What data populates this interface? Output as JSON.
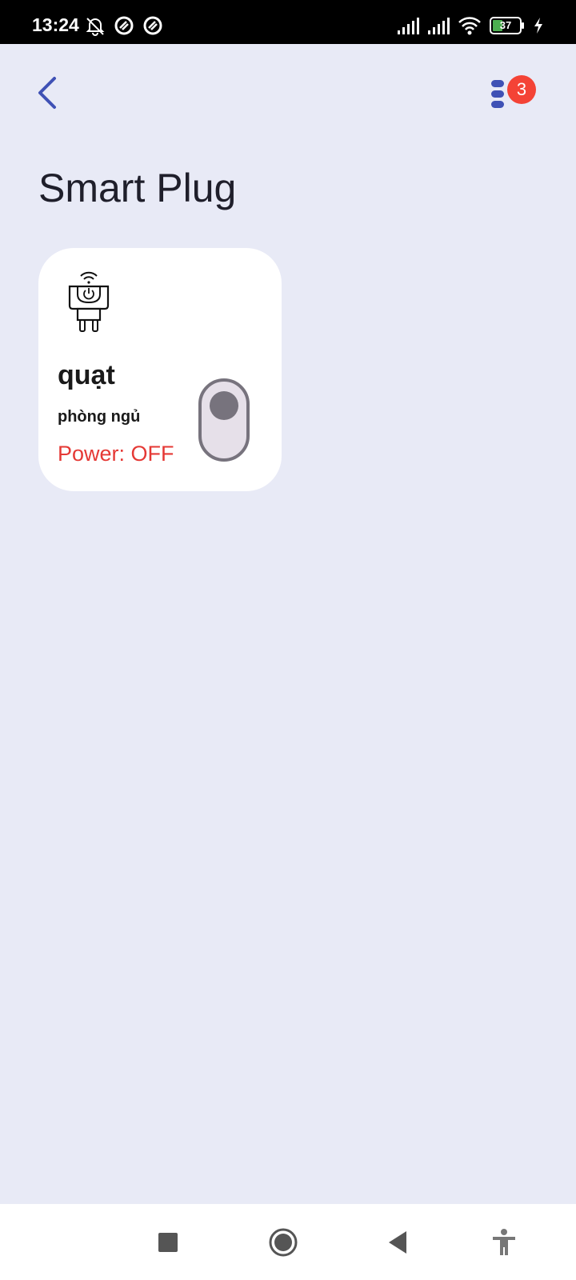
{
  "status_bar": {
    "time": "13:24",
    "battery": "37",
    "icons": [
      "muted-bell-icon",
      "sync-icon",
      "sync-icon",
      "signal-icon",
      "signal-icon",
      "wifi-icon",
      "battery-icon",
      "charging-icon"
    ]
  },
  "header": {
    "back_icon": "chevron-left-icon",
    "menu_icon": "menu-icon",
    "notification_count": "3"
  },
  "page": {
    "title": "Smart Plug"
  },
  "devices": [
    {
      "icon": "smart-plug-icon",
      "name": "quạt",
      "room": "phòng ngủ",
      "power_text": "Power: OFF",
      "power_on": false
    }
  ],
  "colors": {
    "background": "#e8eaf6",
    "accent": "#3f51b5",
    "badge": "#f44336",
    "power_off": "#e53935",
    "toggle": "#77737d"
  },
  "nav_bar": {
    "buttons": [
      "recents-icon",
      "home-icon",
      "back-icon",
      "accessibility-icon"
    ]
  }
}
